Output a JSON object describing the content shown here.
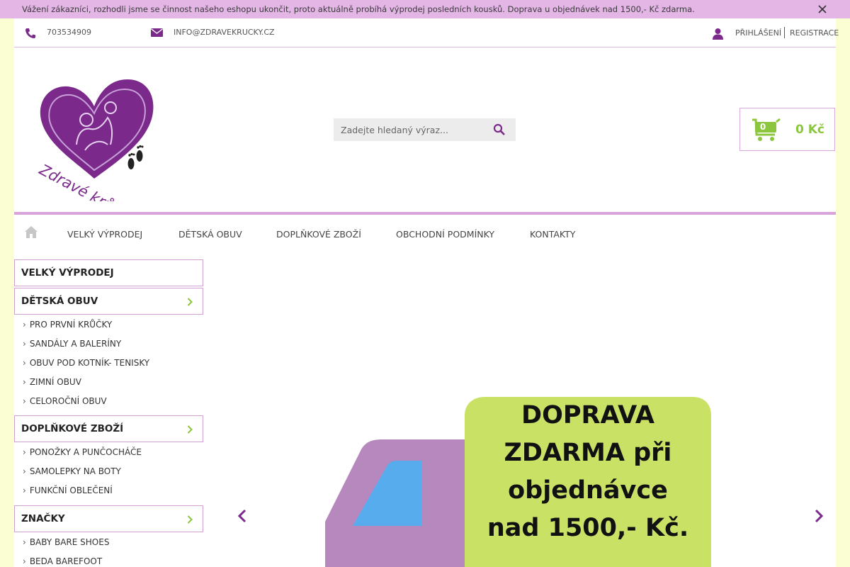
{
  "notice": {
    "text": "Vážení zákazníci, rozhodli jsme se činnost našeho eshopu ukončit, proto aktuálně probíhá výprodej posledních kousků. Doprava u objednávek nad 1500,- Kč zdarma."
  },
  "topbar": {
    "phone": "703534909",
    "email": "info@zdravekrucky.cz",
    "login": "Přihlášení",
    "register": "Registrace"
  },
  "logo": {
    "text": "Zdravé krůčky"
  },
  "search": {
    "placeholder": "Zadejte hledaný výraz..."
  },
  "cart": {
    "count": "0",
    "total": "0 Kč"
  },
  "nav": {
    "items": [
      {
        "label": "Velký výprodej"
      },
      {
        "label": "Dětská obuv"
      },
      {
        "label": "Doplňkové zboží"
      },
      {
        "label": "Obchodní podmínky"
      },
      {
        "label": "Kontakty"
      }
    ]
  },
  "sidebar": {
    "sale": "Velký výprodej",
    "kids_shoes": {
      "label": "Dětská obuv",
      "items": [
        "Pro první krůčky",
        "Sandály a baleríny",
        "Obuv pod kotník- tenisky",
        "Zimní obuv",
        "Celoroční obuv"
      ]
    },
    "accessories": {
      "label": "Doplňkové zboží",
      "items": [
        "Ponožky a punčocháče",
        "Samolepky na boty",
        "Funkční oblečení"
      ]
    },
    "brands": {
      "label": "Značky",
      "items": [
        "Baby bare shoes",
        "Beda barefoot"
      ]
    }
  },
  "banner": {
    "line1": "DOPRAVA",
    "line2": "ZDARMA při",
    "line3": "objednávce",
    "line4": "nad 1500,- Kč."
  },
  "colors": {
    "accent_purple": "#7b2a8c",
    "accent_green": "#8cc63e",
    "notice_bg": "#e3b6e6",
    "outer_bg": "#fbfdd2"
  }
}
